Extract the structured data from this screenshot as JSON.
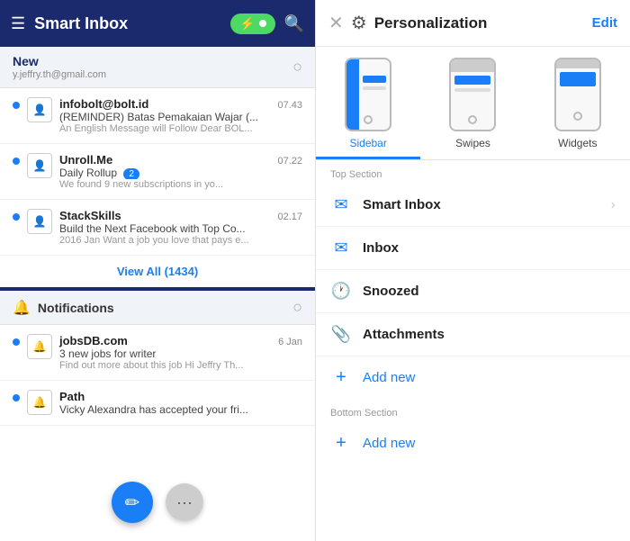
{
  "left": {
    "header": {
      "title": "Smart Inbox",
      "menu_label": "☰",
      "search_label": "🔍"
    },
    "new_section": {
      "title": "New",
      "subtitle": "y.jeffry.th@gmail.com"
    },
    "emails": [
      {
        "from": "infobolt@bolt.id",
        "time": "07.43",
        "subject": "(REMINDER) Batas Pemakaian Wajar (...",
        "preview": "An English Message will Follow Dear BOL...",
        "has_dot": true
      },
      {
        "from": "Unroll.Me",
        "time": "07.22",
        "subject": "Daily Rollup",
        "preview": "We found 9 new subscriptions in yo...",
        "badge": "2",
        "has_dot": true
      },
      {
        "from": "StackSkills",
        "time": "02.17",
        "subject": "Build the Next Facebook with Top Co...",
        "preview": "2016 Jan Want a job you love that pays e...",
        "has_dot": true
      }
    ],
    "view_all": "View All (1434)",
    "notifications": {
      "title": "Notifications"
    },
    "notif_items": [
      {
        "from": "jobsDB.com",
        "time": "6 Jan",
        "subject": "3 new jobs for writer",
        "preview": "Find out more about this job Hi Jeffry Th...",
        "has_dot": true
      },
      {
        "from": "Path",
        "time": "",
        "subject": "Vicky Alexandra has accepted your fri...",
        "preview": "",
        "has_dot": true
      }
    ],
    "fab_edit": "✏",
    "fab_more": "···"
  },
  "right": {
    "header": {
      "close": "✕",
      "icon": "⚙",
      "title": "Personalization",
      "edit": "Edit"
    },
    "phone_options": [
      {
        "label": "Sidebar",
        "active": true
      },
      {
        "label": "Swipes",
        "active": false
      },
      {
        "label": "Widgets",
        "active": false
      }
    ],
    "top_section_label": "Top Section",
    "menu_items": [
      {
        "icon": "✉",
        "icon_class": "smart-inbox-icon",
        "label": "Smart Inbox",
        "has_chevron": true
      },
      {
        "icon": "✉",
        "icon_class": "inbox-icon",
        "label": "Inbox",
        "has_chevron": false
      },
      {
        "icon": "🕐",
        "icon_class": "snoozed-icon",
        "label": "Snoozed",
        "has_chevron": false
      },
      {
        "icon": "📎",
        "icon_class": "attachments-icon",
        "label": "Attachments",
        "has_chevron": false
      }
    ],
    "add_new_top": "Add new",
    "bottom_section_label": "Bottom Section",
    "add_new_bottom": "Add new"
  }
}
